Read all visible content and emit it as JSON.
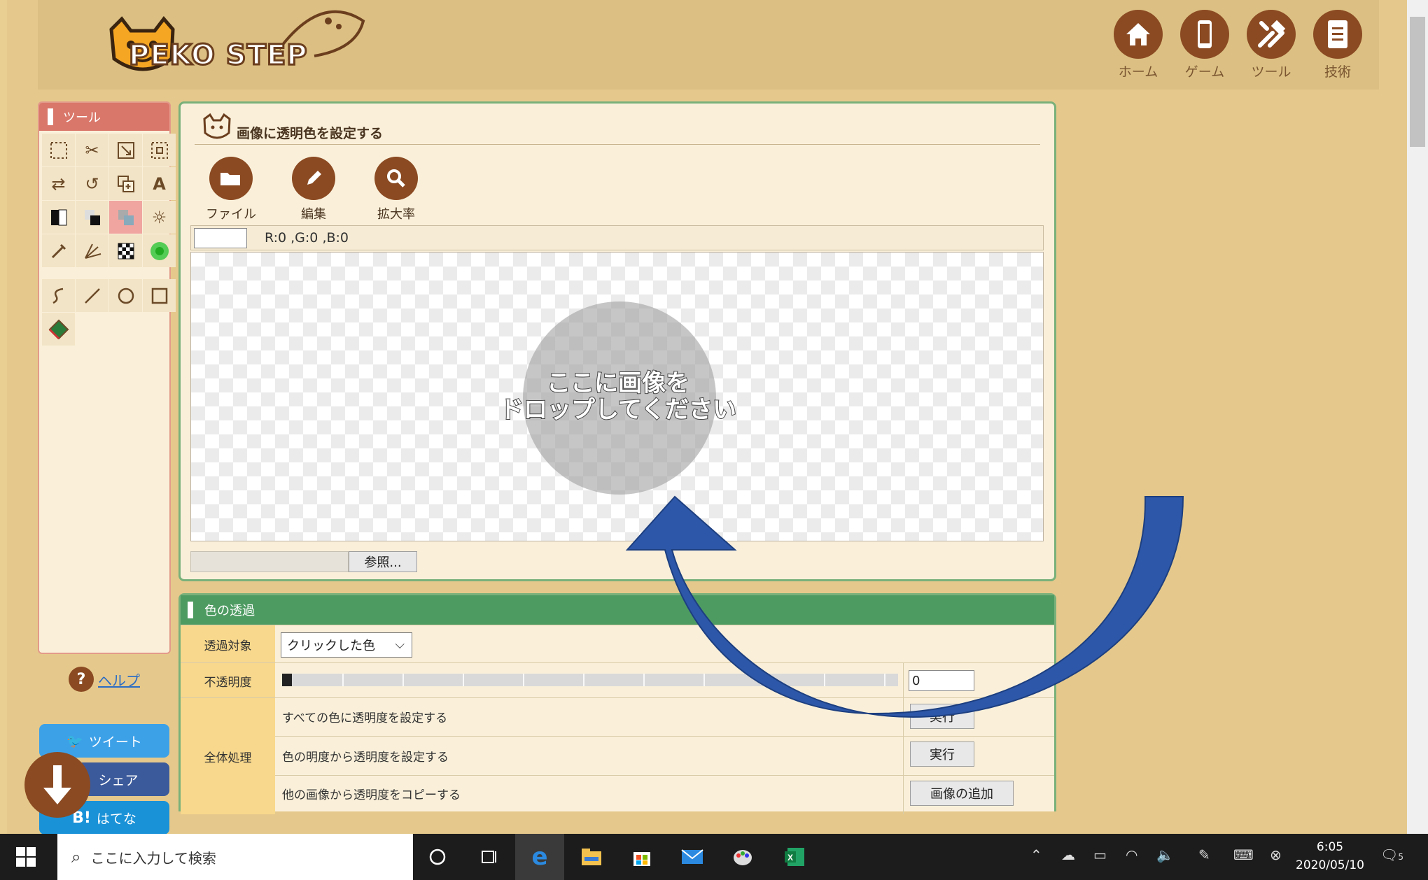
{
  "header": {
    "logo_text": "PEKO STEP",
    "nav": [
      {
        "label": "ホーム",
        "icon": "home-icon"
      },
      {
        "label": "ゲーム",
        "icon": "phone-icon"
      },
      {
        "label": "ツール",
        "icon": "tools-icon"
      },
      {
        "label": "技術",
        "icon": "document-icon"
      }
    ]
  },
  "sidebar": {
    "title": "ツール",
    "help_label": "ヘルプ",
    "social": {
      "tweet": "ツイート",
      "share": "シェア",
      "hatena": "はてな",
      "hatena_prefix": "B!"
    }
  },
  "main": {
    "title": "画像に透明色を設定する",
    "toolbar": [
      {
        "label": "ファイル",
        "icon": "folder-icon"
      },
      {
        "label": "編集",
        "icon": "pencil-icon"
      },
      {
        "label": "拡大率",
        "icon": "magnifier-icon"
      }
    ],
    "rgb_readout": "R:0 ,G:0 ,B:0",
    "drop_text_line1": "ここに画像を",
    "drop_text_line2": "ドロップしてください",
    "browse_label": "参照..."
  },
  "settings": {
    "title": "色の透過",
    "target_label": "透過対象",
    "target_value": "クリックした色",
    "opacity_label": "不透明度",
    "opacity_value": "0",
    "opacity_level": 0,
    "bulk_label": "全体処理",
    "rows": [
      {
        "desc": "すべての色に透明度を設定する",
        "button": "実行"
      },
      {
        "desc": "色の明度から透明度を設定する",
        "button": "実行"
      },
      {
        "desc": "他の画像から透明度をコピーする",
        "button": "画像の追加"
      }
    ]
  },
  "taskbar": {
    "search_placeholder": "ここに入力して検索",
    "time": "6:05",
    "date": "2020/05/10",
    "notification_count": "5"
  },
  "colors": {
    "brand_brown": "#8b4a22",
    "tools_header": "#d9776a",
    "settings_header": "#4e9b62",
    "annotation_arrow": "#2d57a8"
  }
}
